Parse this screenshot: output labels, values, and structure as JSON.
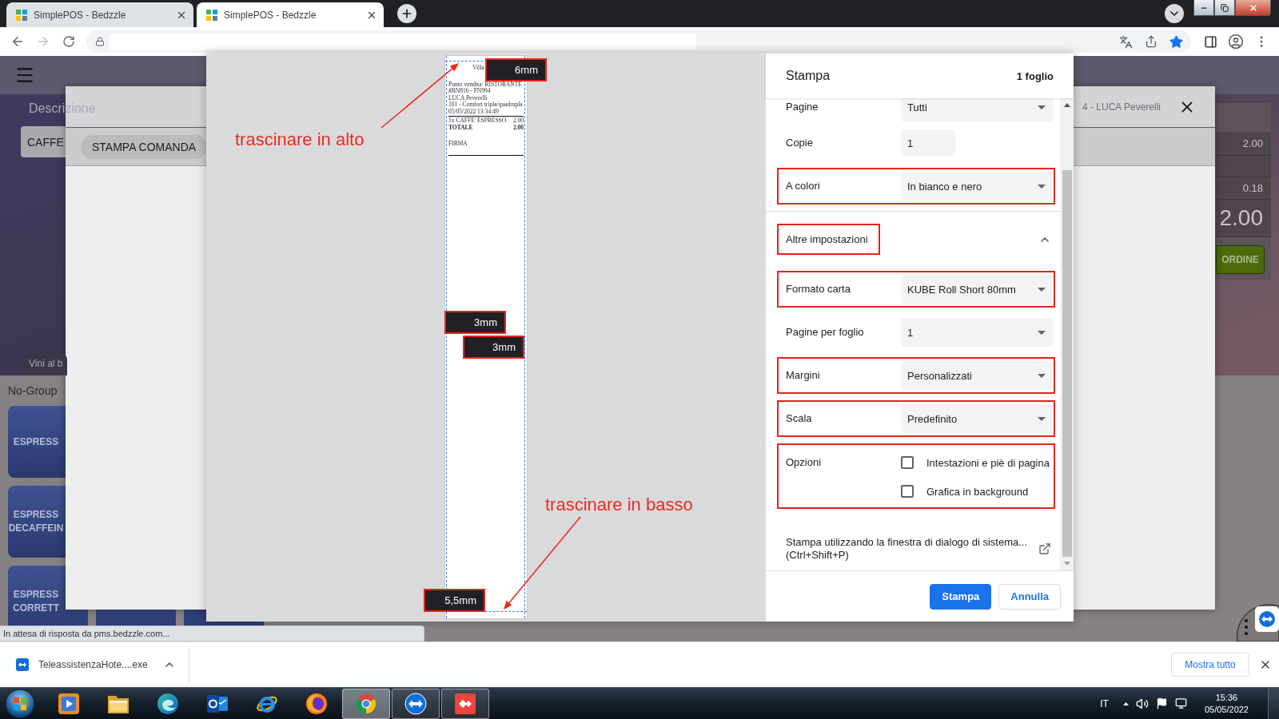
{
  "browser": {
    "tabs": [
      {
        "title": "SimplePOS - Bedzzle",
        "selected": false
      },
      {
        "title": "SimplePOS - Bedzzle",
        "selected": true
      }
    ]
  },
  "pos_app": {
    "description_label": "Descrizione",
    "description_value": "CAFFE",
    "summary_rows": [
      {
        "kind": "value",
        "value": "2.00"
      },
      {
        "kind": "blank"
      },
      {
        "kind": "value",
        "value": "0.18"
      }
    ],
    "total": "2.00",
    "order_button": "ORDINE",
    "category_tab": "Vini al b",
    "group_label": "No-Group",
    "products": [
      "ESPRESS",
      "ESPRESS DECAFFEIN",
      "ESPRESS CORRETT"
    ]
  },
  "modal": {
    "title": "4 - LUCA Peverelli",
    "print_button": "STAMPA COMANDA"
  },
  "print_preview": {
    "receipt": {
      "title": "Villa",
      "lines": [
        "Punto vendita: RISTORANTE",
        "#BN816 - FN994",
        "LUCA Peverelli",
        "101 - Comfort tripla/quadrupla",
        "05/05/2022 13:34:49"
      ],
      "items": [
        {
          "kind": "item",
          "label": "1x CAFFE' ESPRESSO",
          "amount": "2.00"
        },
        {
          "kind": "total",
          "label": "TOTALE",
          "amount": "2.00"
        }
      ],
      "signature": "FIRMA"
    },
    "margin_labels": [
      "6mm",
      "3mm",
      "3mm",
      "5,5mm"
    ],
    "annotations": [
      "trascinare in alto",
      "trascinare in basso"
    ]
  },
  "print_panel": {
    "title": "Stampa",
    "sheet_count": "1 foglio",
    "settings": [
      {
        "kind": "select",
        "label": "Pagine",
        "value": "Tutti",
        "highlighted": false
      },
      {
        "kind": "input",
        "label": "Copie",
        "value": "1",
        "highlighted": false
      },
      {
        "kind": "select",
        "label": "A colori",
        "value": "In bianco e nero",
        "highlighted": true
      },
      {
        "kind": "section",
        "label": "Altre impostazioni",
        "expanded": true,
        "highlighted": true
      },
      {
        "kind": "select",
        "label": "Formato carta",
        "value": "KUBE Roll Short 80mm",
        "highlighted": true
      },
      {
        "kind": "select",
        "label": "Pagine per foglio",
        "value": "1",
        "highlighted": false
      },
      {
        "kind": "select",
        "label": "Margini",
        "value": "Personalizzati",
        "highlighted": true
      },
      {
        "kind": "select",
        "label": "Scala",
        "value": "Predefinito",
        "highlighted": true
      },
      {
        "kind": "checkboxes",
        "label": "Opzioni",
        "highlighted": true,
        "options": [
          {
            "label": "Intestazioni e piè di pagina",
            "checked": false
          },
          {
            "label": "Grafica in background",
            "checked": false
          }
        ]
      },
      {
        "kind": "link",
        "label": "Stampa utilizzando la finestra di dialogo di sistema...",
        "shortcut": "(Ctrl+Shift+P)"
      }
    ],
    "buttons": [
      {
        "kind": "primary",
        "label": "Stampa"
      },
      {
        "kind": "secondary",
        "label": "Annulla"
      }
    ]
  },
  "status_bubble": "In attesa di risposta da pms.bedzzle.com...",
  "download_bar": {
    "items": [
      {
        "filename": "TeleassistenzaHote....exe"
      }
    ],
    "show_all_button": "Mostra tutto"
  },
  "taskbar": {
    "apps": [
      {
        "kind": "player",
        "active": false,
        "selected": false
      },
      {
        "kind": "folder",
        "active": false,
        "selected": false
      },
      {
        "kind": "swirl",
        "active": false,
        "selected": false
      },
      {
        "kind": "mail",
        "active": false,
        "selected": false
      },
      {
        "kind": "orbit",
        "active": false,
        "selected": false
      },
      {
        "kind": "flame",
        "active": false,
        "selected": false
      },
      {
        "kind": "segments",
        "active": true,
        "selected": true
      },
      {
        "kind": "remote",
        "active": true,
        "selected": false
      },
      {
        "kind": "diamond",
        "active": true,
        "selected": false
      }
    ],
    "language": "IT",
    "time": "15:36",
    "date": "05/05/2022"
  }
}
